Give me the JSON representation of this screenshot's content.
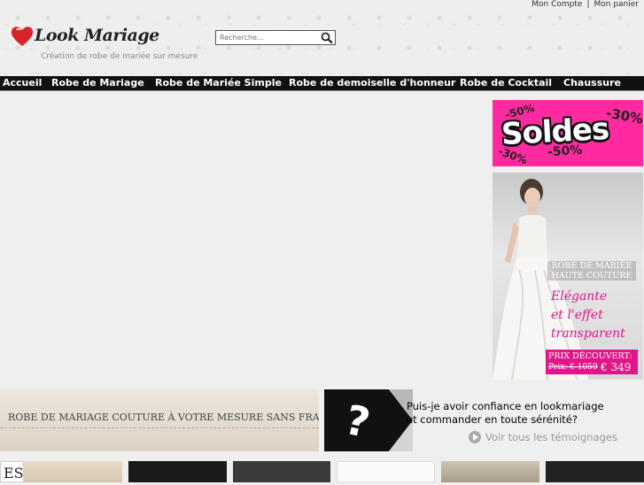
{
  "header": {
    "account_link": "Mon Compte",
    "separator": "|",
    "cart_link": "Mon panier",
    "logo_text": "Look Mariage",
    "tagline": "Création de robe de mariée sur mesure",
    "search_placeholder": "Recherche..."
  },
  "nav": {
    "items": [
      {
        "label": "Accueil"
      },
      {
        "label": "Robe de Mariage"
      },
      {
        "label": "Robe de Mariée Simple"
      },
      {
        "label": "Robe de demoiselle d'honneur"
      },
      {
        "label": "Robe de Cocktail"
      },
      {
        "label": "Chaussure"
      }
    ]
  },
  "sidebar": {
    "soldes": {
      "title": "Soldes",
      "discounts": [
        "-50%",
        "-30%",
        "-30%",
        "-50%"
      ]
    },
    "ad": {
      "title_line1": "ROBE DE MARIÉE",
      "title_line2": "HAUTE COUTURE",
      "slogan_line1": "Elégante",
      "slogan_line2": "et l'effet",
      "slogan_line3": "transparent",
      "price_label": "PRIX DÉCOUVERT:",
      "old_price": "Prix: € 1059",
      "new_price": "€ 349"
    }
  },
  "banners": {
    "left_text": "ROBE DE MARIAGE COUTURE À VOTRE MESURE SANS FRAIS",
    "question_line1": "Puis-je avoir confiance en lookmariage",
    "question_line2": "et commander en toute sérénité?",
    "testimonials_link": "Voir tous les témoignages"
  },
  "colors": {
    "accent_pink": "#e0168a",
    "nav_bg": "#111111",
    "soldes_bg": "#ff2aa0"
  }
}
